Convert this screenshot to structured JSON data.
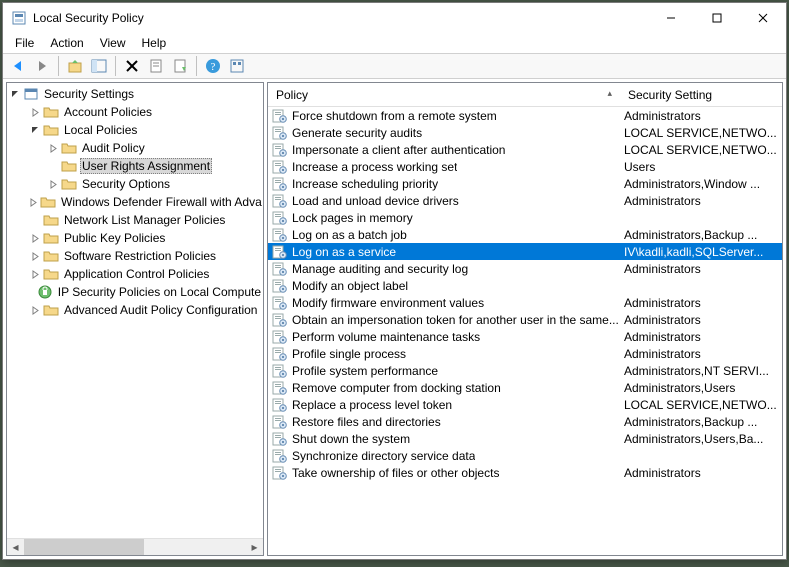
{
  "window": {
    "title": "Local Security Policy"
  },
  "menu": {
    "file": "File",
    "action": "Action",
    "view": "View",
    "help": "Help"
  },
  "tree": {
    "root": "Security Settings",
    "items": [
      {
        "label": "Account Policies",
        "depth": 1,
        "expander": ">"
      },
      {
        "label": "Local Policies",
        "depth": 1,
        "expander": "v"
      },
      {
        "label": "Audit Policy",
        "depth": 2,
        "expander": ">"
      },
      {
        "label": "User Rights Assignment",
        "depth": 2,
        "expander": "",
        "selected": true
      },
      {
        "label": "Security Options",
        "depth": 2,
        "expander": ">"
      },
      {
        "label": "Windows Defender Firewall with Adva",
        "depth": 1,
        "expander": ">"
      },
      {
        "label": "Network List Manager Policies",
        "depth": 1,
        "expander": ""
      },
      {
        "label": "Public Key Policies",
        "depth": 1,
        "expander": ">"
      },
      {
        "label": "Software Restriction Policies",
        "depth": 1,
        "expander": ">"
      },
      {
        "label": "Application Control Policies",
        "depth": 1,
        "expander": ">"
      },
      {
        "label": "IP Security Policies on Local Compute",
        "depth": 1,
        "expander": "",
        "iconType": "ipsec"
      },
      {
        "label": "Advanced Audit Policy Configuration",
        "depth": 1,
        "expander": ">"
      }
    ]
  },
  "list": {
    "columns": {
      "policy": "Policy",
      "setting": "Security Setting"
    },
    "rows": [
      {
        "policy": "Force shutdown from a remote system",
        "setting": "Administrators"
      },
      {
        "policy": "Generate security audits",
        "setting": "LOCAL SERVICE,NETWO..."
      },
      {
        "policy": "Impersonate a client after authentication",
        "setting": "LOCAL SERVICE,NETWO..."
      },
      {
        "policy": "Increase a process working set",
        "setting": "Users"
      },
      {
        "policy": "Increase scheduling priority",
        "setting": "Administrators,Window ..."
      },
      {
        "policy": "Load and unload device drivers",
        "setting": "Administrators"
      },
      {
        "policy": "Lock pages in memory",
        "setting": ""
      },
      {
        "policy": "Log on as a batch job",
        "setting": "Administrators,Backup ..."
      },
      {
        "policy": "Log on as a service",
        "setting": "IV\\kadli,kadli,SQLServer...",
        "selected": true
      },
      {
        "policy": "Manage auditing and security log",
        "setting": "Administrators"
      },
      {
        "policy": "Modify an object label",
        "setting": ""
      },
      {
        "policy": "Modify firmware environment values",
        "setting": "Administrators"
      },
      {
        "policy": "Obtain an impersonation token for another user in the same...",
        "setting": "Administrators"
      },
      {
        "policy": "Perform volume maintenance tasks",
        "setting": "Administrators"
      },
      {
        "policy": "Profile single process",
        "setting": "Administrators"
      },
      {
        "policy": "Profile system performance",
        "setting": "Administrators,NT SERVI..."
      },
      {
        "policy": "Remove computer from docking station",
        "setting": "Administrators,Users"
      },
      {
        "policy": "Replace a process level token",
        "setting": "LOCAL SERVICE,NETWO..."
      },
      {
        "policy": "Restore files and directories",
        "setting": "Administrators,Backup ..."
      },
      {
        "policy": "Shut down the system",
        "setting": "Administrators,Users,Ba..."
      },
      {
        "policy": "Synchronize directory service data",
        "setting": ""
      },
      {
        "policy": "Take ownership of files or other objects",
        "setting": "Administrators"
      }
    ]
  }
}
